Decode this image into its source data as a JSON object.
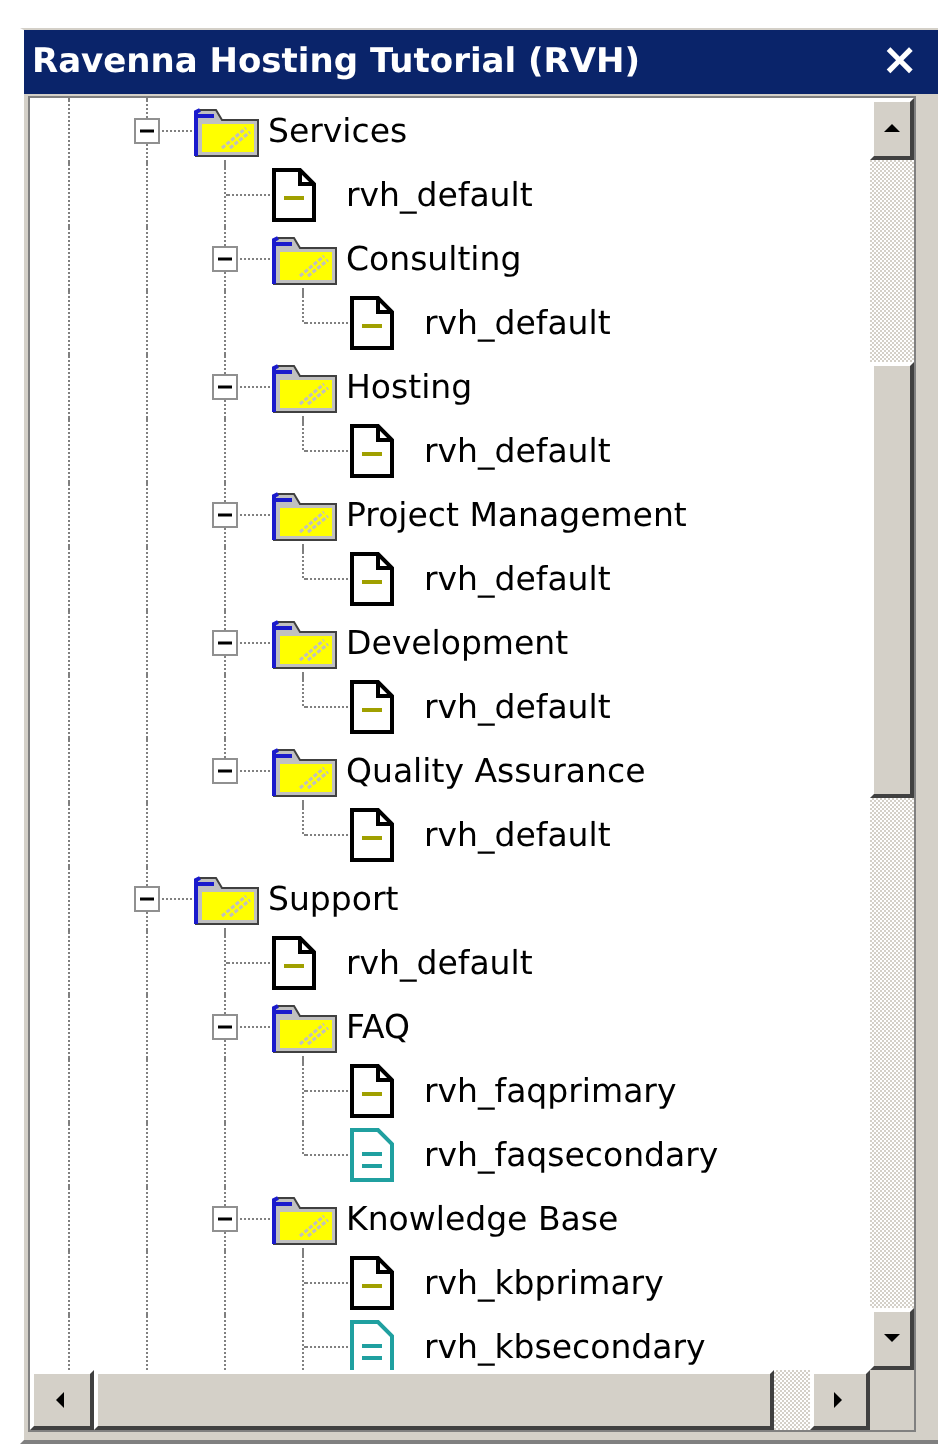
{
  "window": {
    "title": "Ravenna Hosting Tutorial (RVH)",
    "close": "×"
  },
  "tree": [
    {
      "label": "Services",
      "kind": "folder",
      "expanded": true,
      "children": [
        {
          "label": "rvh_default",
          "kind": "page"
        },
        {
          "label": "Consulting",
          "kind": "folder",
          "expanded": true,
          "children": [
            {
              "label": "rvh_default",
              "kind": "page"
            }
          ]
        },
        {
          "label": "Hosting",
          "kind": "folder",
          "expanded": true,
          "children": [
            {
              "label": "rvh_default",
              "kind": "page"
            }
          ]
        },
        {
          "label": "Project Management",
          "kind": "folder",
          "expanded": true,
          "children": [
            {
              "label": "rvh_default",
              "kind": "page"
            }
          ]
        },
        {
          "label": "Development",
          "kind": "folder",
          "expanded": true,
          "children": [
            {
              "label": "rvh_default",
              "kind": "page"
            }
          ]
        },
        {
          "label": "Quality Assurance",
          "kind": "folder",
          "expanded": true,
          "children": [
            {
              "label": "rvh_default",
              "kind": "page"
            }
          ]
        }
      ]
    },
    {
      "label": "Support",
      "kind": "folder",
      "expanded": true,
      "children": [
        {
          "label": "rvh_default",
          "kind": "page"
        },
        {
          "label": "FAQ",
          "kind": "folder",
          "expanded": true,
          "children": [
            {
              "label": "rvh_faqprimary",
              "kind": "page"
            },
            {
              "label": "rvh_faqsecondary",
              "kind": "secondary_page"
            }
          ]
        },
        {
          "label": "Knowledge Base",
          "kind": "folder",
          "expanded": true,
          "children": [
            {
              "label": "rvh_kbprimary",
              "kind": "page"
            },
            {
              "label": "rvh_kbsecondary",
              "kind": "secondary_page"
            }
          ]
        }
      ]
    }
  ]
}
